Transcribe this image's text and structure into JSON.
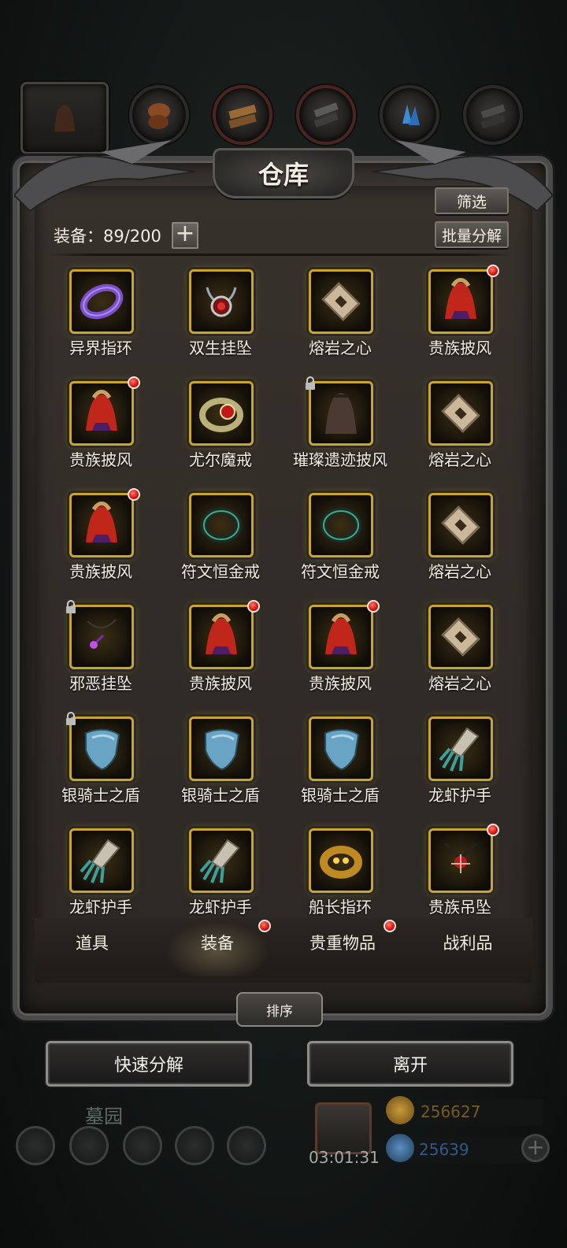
{
  "panel": {
    "title": "仓库",
    "count_label": "装备：89/200",
    "plus_label": "+",
    "filter_label": "筛选",
    "bulk_dismantle_label": "批量分解"
  },
  "category_tabs": [
    {
      "icon": "cloak-icon"
    },
    {
      "icon": "ore-icon"
    },
    {
      "icon": "wood-icon"
    },
    {
      "icon": "iron-icon"
    },
    {
      "icon": "crystal-icon"
    },
    {
      "icon": "stone-icon"
    }
  ],
  "items": [
    {
      "name": "异界指环",
      "icon": "purple-ring-icon",
      "new": false,
      "locked": false
    },
    {
      "name": "双生挂坠",
      "icon": "amulet-icon",
      "new": false,
      "locked": false
    },
    {
      "name": "熔岩之心",
      "icon": "lava-heart-icon",
      "new": false,
      "locked": false
    },
    {
      "name": "贵族披风",
      "icon": "red-cloak-icon",
      "new": true,
      "locked": false
    },
    {
      "name": "贵族披风",
      "icon": "red-cloak-icon",
      "new": true,
      "locked": false
    },
    {
      "name": "尤尔魔戒",
      "icon": "ruby-ring-icon",
      "new": false,
      "locked": false
    },
    {
      "name": "璀璨遗迹披风",
      "icon": "dark-cloak-icon",
      "new": false,
      "locked": true
    },
    {
      "name": "熔岩之心",
      "icon": "lava-heart-icon",
      "new": false,
      "locked": false
    },
    {
      "name": "贵族披风",
      "icon": "red-cloak-icon",
      "new": true,
      "locked": false
    },
    {
      "name": "符文恒金戒",
      "icon": "green-ring-icon",
      "new": false,
      "locked": false
    },
    {
      "name": "符文恒金戒",
      "icon": "green-ring-icon",
      "new": false,
      "locked": false
    },
    {
      "name": "熔岩之心",
      "icon": "lava-heart-icon",
      "new": false,
      "locked": false
    },
    {
      "name": "邪恶挂坠",
      "icon": "evil-pendant-icon",
      "new": false,
      "locked": true
    },
    {
      "name": "贵族披风",
      "icon": "red-cloak-icon",
      "new": true,
      "locked": false
    },
    {
      "name": "贵族披风",
      "icon": "red-cloak-icon",
      "new": true,
      "locked": false
    },
    {
      "name": "熔岩之心",
      "icon": "lava-heart-icon",
      "new": false,
      "locked": false
    },
    {
      "name": "银骑士之盾",
      "icon": "silver-shield-icon",
      "new": false,
      "locked": true
    },
    {
      "name": "银骑士之盾",
      "icon": "silver-shield-icon",
      "new": false,
      "locked": false
    },
    {
      "name": "银骑士之盾",
      "icon": "silver-shield-icon",
      "new": false,
      "locked": false
    },
    {
      "name": "龙虾护手",
      "icon": "claw-gauntlet-icon",
      "new": false,
      "locked": false
    },
    {
      "name": "龙虾护手",
      "icon": "claw-gauntlet-icon",
      "new": false,
      "locked": false
    },
    {
      "name": "龙虾护手",
      "icon": "claw-gauntlet-icon",
      "new": false,
      "locked": false
    },
    {
      "name": "船长指环",
      "icon": "gold-ring-icon",
      "new": false,
      "locked": false
    },
    {
      "name": "贵族吊坠",
      "icon": "noble-pendant-icon",
      "new": true,
      "locked": false
    }
  ],
  "bottom_tabs": [
    {
      "label": "道具",
      "has_dot": false
    },
    {
      "label": "装备",
      "has_dot": true,
      "active": true
    },
    {
      "label": "贵重物品",
      "has_dot": true
    },
    {
      "label": "战利品",
      "has_dot": false
    }
  ],
  "sort_label": "排序",
  "actions": {
    "quick_dismantle": "快速分解",
    "leave": "离开"
  },
  "hud": {
    "location": "墓园",
    "timer": "03:01:31",
    "gold": "256627",
    "gems": "25639",
    "gold_color": "#7a5a1e",
    "gem_color": "#2e5a8a"
  },
  "colors": {
    "slot_border": "#c9a52b",
    "badge": "#d4120c"
  }
}
